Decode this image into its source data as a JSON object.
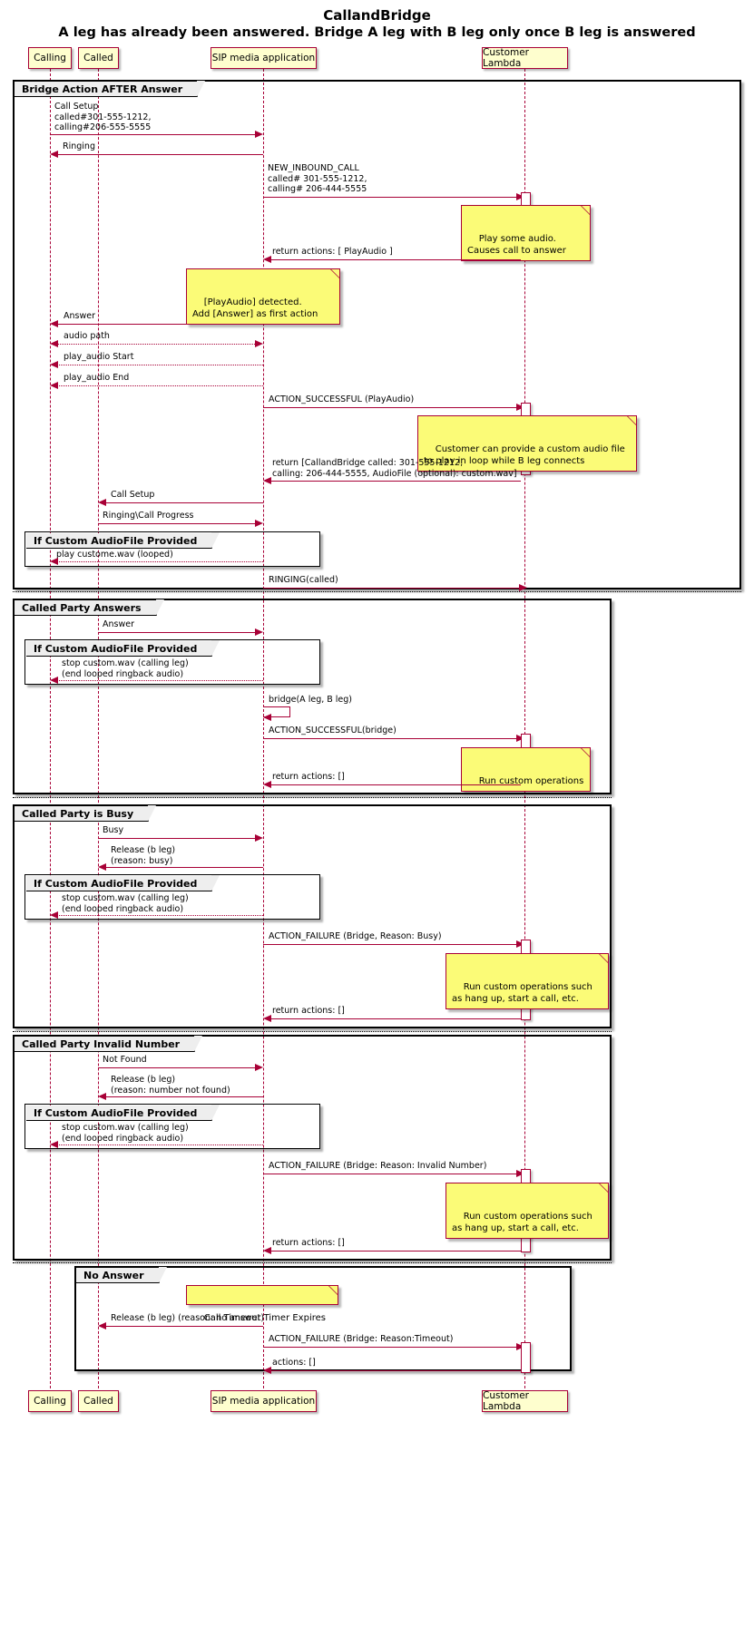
{
  "diagram": {
    "title": "CallandBridge",
    "subtitle": "A leg has already been answered. Bridge A leg with B leg only once B leg is answered"
  },
  "participants": [
    {
      "id": "calling",
      "label": "Calling"
    },
    {
      "id": "called",
      "label": "Called"
    },
    {
      "id": "sma",
      "label": "SIP media application"
    },
    {
      "id": "lambda",
      "label": "Customer Lambda"
    }
  ],
  "participants_footer": [
    {
      "id": "calling",
      "label": "Calling"
    },
    {
      "id": "called",
      "label": "Called"
    },
    {
      "id": "sma",
      "label": "SIP media application"
    },
    {
      "id": "lambda",
      "label": "Customer Lambda"
    }
  ],
  "groups": [
    {
      "id": "g_main",
      "label": "Bridge Action AFTER Answer"
    },
    {
      "id": "g_af1",
      "label": "If Custom AudioFile Provided"
    },
    {
      "id": "g_answer",
      "label": "Called Party Answers"
    },
    {
      "id": "g_af2",
      "label": "If Custom AudioFile Provided"
    },
    {
      "id": "g_busy",
      "label": "Called Party is Busy"
    },
    {
      "id": "g_af3",
      "label": "If Custom AudioFile Provided"
    },
    {
      "id": "g_invalid",
      "label": "Called Party Invalid Number"
    },
    {
      "id": "g_af4",
      "label": "If Custom AudioFile Provided"
    },
    {
      "id": "g_noans",
      "label": "No Answer"
    }
  ],
  "messages": [
    {
      "id": "m01",
      "text": "Call Setup\ncalled#301-555-1212,\ncalling#206-555-5555"
    },
    {
      "id": "m02",
      "text": "Ringing"
    },
    {
      "id": "m03",
      "text": "NEW_INBOUND_CALL\ncalled# 301-555-1212,\ncalling# 206-444-5555"
    },
    {
      "id": "m04",
      "text": "return actions: [ PlayAudio ]"
    },
    {
      "id": "m05",
      "text": "Answer"
    },
    {
      "id": "m06",
      "text": "audio path"
    },
    {
      "id": "m07",
      "text": "play_audio Start"
    },
    {
      "id": "m08",
      "text": "play_audio End"
    },
    {
      "id": "m09",
      "text": "ACTION_SUCCESSFUL (PlayAudio)"
    },
    {
      "id": "m10",
      "text": "return [CallandBridge called: 301-555-1212,\ncalling: 206-444-5555, AudioFile (optional): custom.wav]"
    },
    {
      "id": "m11",
      "text": "Call Setup"
    },
    {
      "id": "m12",
      "text": "Ringing\\Call Progress"
    },
    {
      "id": "m13",
      "text": "play custome.wav (looped)"
    },
    {
      "id": "m14",
      "text": "RINGING(called)"
    },
    {
      "id": "m15",
      "text": "Answer"
    },
    {
      "id": "m16",
      "text": "stop custom.wav (calling leg)\n(end looped ringback audio)"
    },
    {
      "id": "m17",
      "text": "bridge(A leg, B leg)"
    },
    {
      "id": "m18",
      "text": "ACTION_SUCCESSFUL(bridge)"
    },
    {
      "id": "m19",
      "text": "return actions: []"
    },
    {
      "id": "m20",
      "text": "Busy"
    },
    {
      "id": "m21",
      "text": "Release (b leg)\n(reason: busy)"
    },
    {
      "id": "m22",
      "text": "stop custom.wav (calling leg)\n(end looped ringback audio)"
    },
    {
      "id": "m23",
      "text": "ACTION_FAILURE (Bridge, Reason: Busy)"
    },
    {
      "id": "m24",
      "text": "return actions: []"
    },
    {
      "id": "m25",
      "text": "Not Found"
    },
    {
      "id": "m26",
      "text": "Release (b leg)\n(reason: number not found)"
    },
    {
      "id": "m27",
      "text": "stop custom.wav (calling leg)\n(end looped ringback audio)"
    },
    {
      "id": "m28",
      "text": "ACTION_FAILURE (Bridge: Reason: Invalid Number)"
    },
    {
      "id": "m29",
      "text": "return actions: []"
    },
    {
      "id": "m30",
      "text": "Release (b leg) (reason: no answer)"
    },
    {
      "id": "m31",
      "text": "ACTION_FAILURE (Bridge: Reason:Timeout)"
    },
    {
      "id": "m32",
      "text": "actions: []"
    }
  ],
  "notes": [
    {
      "id": "n1",
      "text": "Play some audio.\nCauses call to answer"
    },
    {
      "id": "n2",
      "text": "[PlayAudio] detected.\nAdd [Answer] as first action"
    },
    {
      "id": "n3",
      "text": "Customer can provide a custom audio file\nto play in loop while B leg connects"
    },
    {
      "id": "n4",
      "text": "Run custom operations"
    },
    {
      "id": "n5",
      "text": "Run custom operations such\nas hang up, start a call, etc."
    },
    {
      "id": "n6",
      "text": "Run custom operations such\nas hang up, start a call, etc."
    },
    {
      "id": "n7",
      "text": "Call Timeout Timer Expires"
    }
  ],
  "colors": {
    "participant_fill": "#FEFECE",
    "participant_border": "#A80036",
    "arrow": "#A80036",
    "note_fill": "#FBFB77",
    "group_tab_fill": "#EEEEEE"
  }
}
